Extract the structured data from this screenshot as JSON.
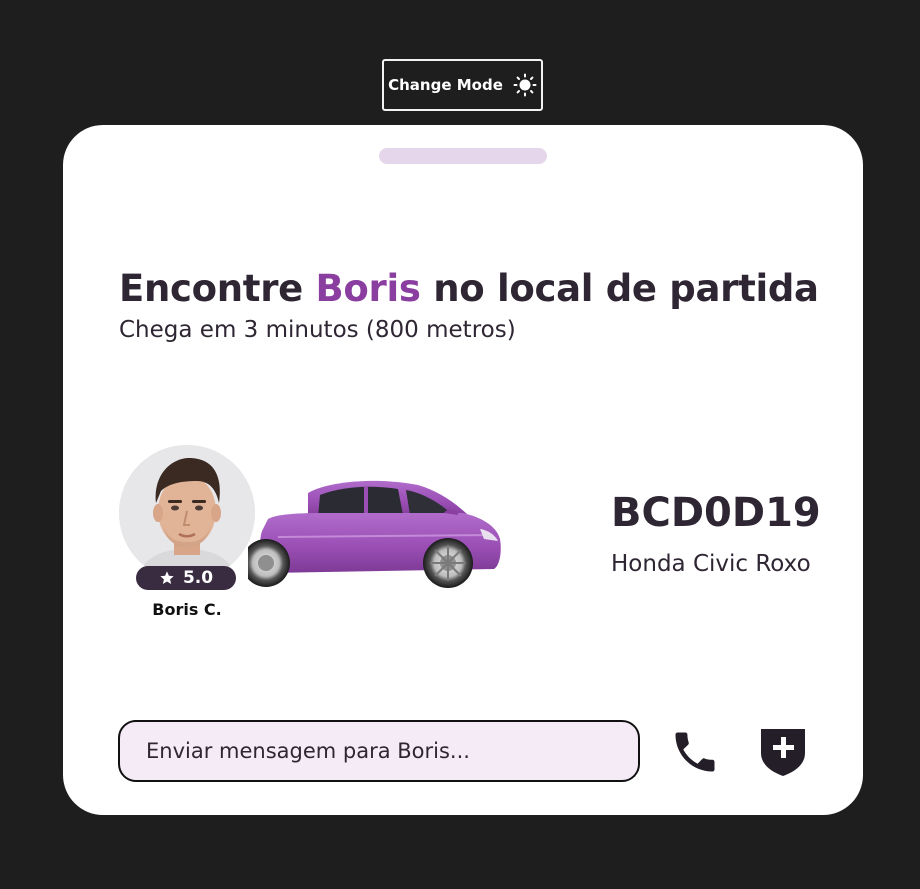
{
  "toolbar": {
    "mode_label": "Change Mode",
    "mode_icon": "sun-icon"
  },
  "colors": {
    "page_background": "#1e1e1e",
    "card_background": "#ffffff",
    "accent": "#8a3fa0",
    "text_dark": "#2f2634",
    "input_background": "#f4ebf7",
    "handle": "#e6d6ec",
    "car_body": "#9b4fb5"
  },
  "ride": {
    "headline_prefix": "Encontre",
    "driver_first_name": "Boris",
    "headline_suffix": "no local de partida",
    "arrival": "Chega em 3 minutos (800 metros)"
  },
  "driver": {
    "display_name": "Boris C.",
    "rating": "5.0",
    "rating_icon": "star-icon",
    "avatar_icon": "driver-avatar"
  },
  "vehicle": {
    "plate": "BCD0D19",
    "model": "Honda Civic Roxo",
    "image": "purple-car"
  },
  "chat": {
    "placeholder": "Enviar mensagem para Boris..."
  },
  "actions": {
    "call_icon": "phone-icon",
    "safety_icon": "shield-plus-icon"
  }
}
